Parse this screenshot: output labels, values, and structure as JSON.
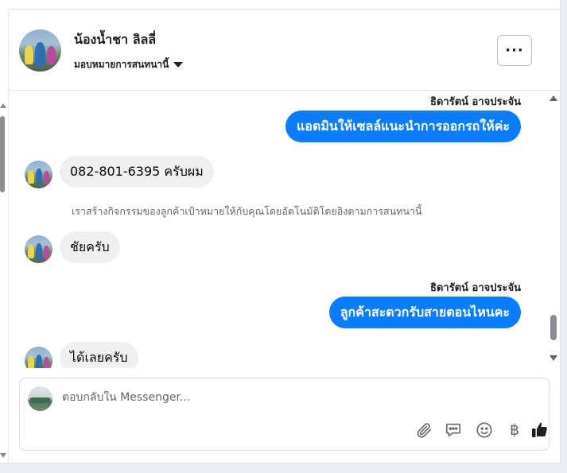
{
  "header": {
    "contact_name": "น้องน้ำชา ลิลลี่",
    "assign_label": "มอบหมายการสนทนานี้",
    "more_label": "···"
  },
  "messages": [
    {
      "direction": "out",
      "sender": "ธิดารัตน์ อาจประจัน",
      "text": "แอดมินให้เซลล์แนะนำการออกรถให้ค่ะ"
    },
    {
      "direction": "in",
      "text": "082-801-6395 ครับผม"
    },
    {
      "direction": "system",
      "text": "เราสร้างกิจกรรมของลูกค้าเป้าหมายให้กับคุณโดยอัตโนมัติโดยอิงตามการสนทนานี้"
    },
    {
      "direction": "in",
      "text": "ชัยครับ"
    },
    {
      "direction": "out",
      "sender": "ธิดารัตน์ อาจประจัน",
      "text": "ลูกค้าสะดวกรับสายตอนไหนคะ"
    },
    {
      "direction": "in",
      "text": "ได้เลยครับ"
    }
  ],
  "composer": {
    "placeholder": "ตอบกลับใน Messenger...",
    "currency_symbol": "฿"
  },
  "icons": {
    "attach": "paperclip-icon",
    "saved_replies": "chat-bubble-icon",
    "emoji": "smiley-icon",
    "payment": "baht-icon",
    "like": "thumbs-up-icon"
  },
  "colors": {
    "outgoing_bubble": "#0a7cff",
    "incoming_bubble": "#f0f0f0"
  }
}
